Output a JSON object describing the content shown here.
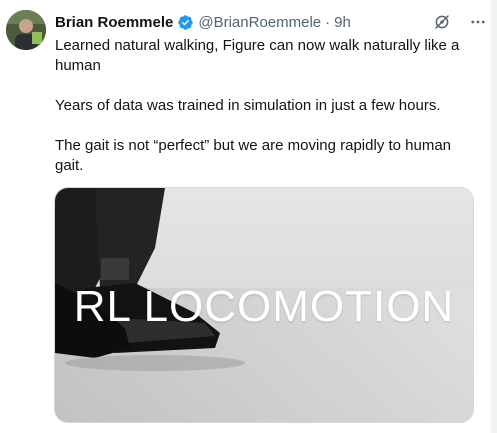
{
  "tweet": {
    "author_name": "Brian Roemmele",
    "handle": "@BrianRoemmele",
    "separator": "·",
    "time": "9h",
    "paragraphs": [
      "Learned natural walking, Figure can now walk naturally like a human",
      "Years of data was trained in simulation in just a few hours.",
      "The gait is not “perfect” but we are moving rapidly to human gait."
    ],
    "media": {
      "overlay_text": "RL LOCOMOTION"
    }
  },
  "icons": {
    "verified": "verified-badge-icon",
    "grok": "grok-icon",
    "more": "more-icon"
  },
  "colors": {
    "verified_blue": "#1d9bf0",
    "secondary_text": "#536471",
    "primary_text": "#0f1419"
  }
}
